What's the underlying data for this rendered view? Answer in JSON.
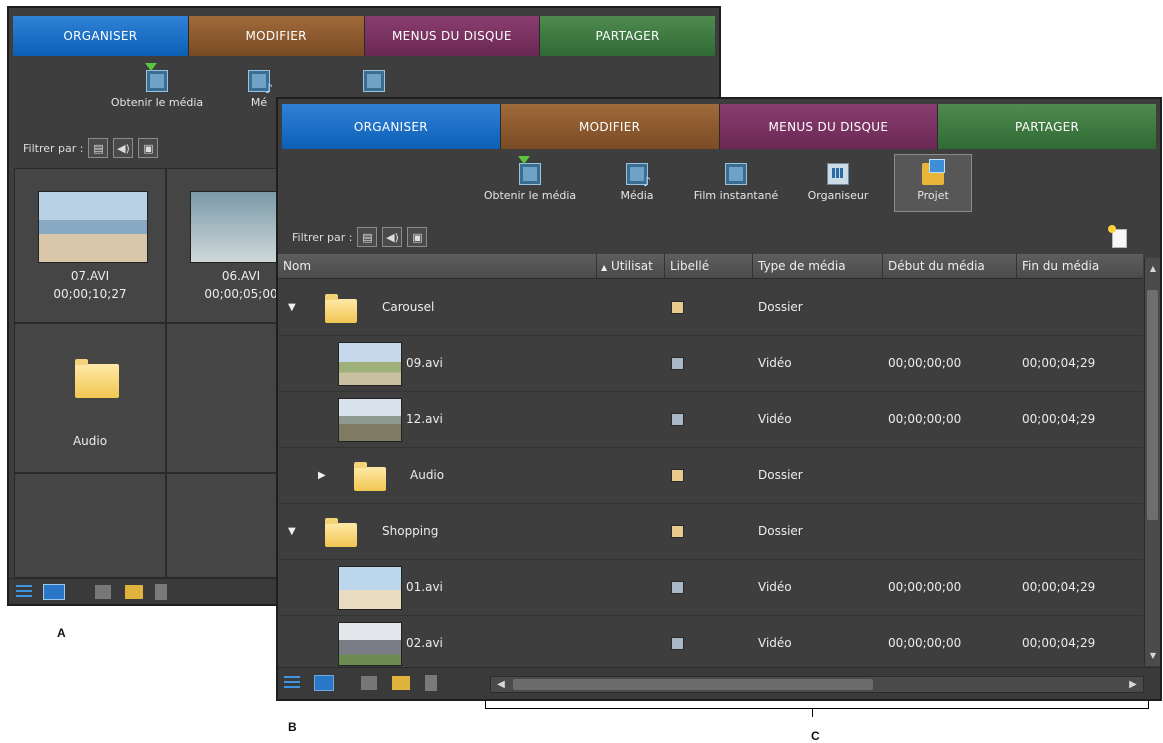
{
  "tabs": [
    "ORGANISER",
    "MODIFIER",
    "MENUS DU DISQUE",
    "PARTAGER"
  ],
  "back_panel": {
    "tools": [
      "Obtenir le média",
      "Mé"
    ],
    "filter_label": "Filtrer par :",
    "grid": [
      {
        "name": "07.AVI",
        "duration": "00;00;10;27"
      },
      {
        "name": "06.AVI",
        "duration": "00;00;05;00"
      },
      {
        "name": "Audio"
      }
    ]
  },
  "front_panel": {
    "tools": [
      "Obtenir le média",
      "Média",
      "Film instantané",
      "Organiseur",
      "Projet"
    ],
    "filter_label": "Filtrer par :",
    "columns": [
      "Nom",
      "Utilisat",
      "Libellé",
      "Type de média",
      "Début du média",
      "Fin du média"
    ],
    "rows": [
      {
        "name": "Carousel",
        "type": "Dossier",
        "start": "",
        "end": "",
        "expand": "open",
        "kind": "folder",
        "color": "#e8c98e"
      },
      {
        "name": "09.avi",
        "type": "Vidéo",
        "start": "00;00;00;00",
        "end": "00;00;04;29",
        "kind": "video",
        "color": "#a9b8c4"
      },
      {
        "name": "12.avi",
        "type": "Vidéo",
        "start": "00;00;00;00",
        "end": "00;00;04;29",
        "kind": "video",
        "color": "#a9b8c4"
      },
      {
        "name": "Audio",
        "type": "Dossier",
        "start": "",
        "end": "",
        "expand": "closed",
        "kind": "folder",
        "color": "#e8c98e"
      },
      {
        "name": "Shopping",
        "type": "Dossier",
        "start": "",
        "end": "",
        "expand": "open",
        "kind": "folder",
        "color": "#e8c98e"
      },
      {
        "name": "01.avi",
        "type": "Vidéo",
        "start": "00;00;00;00",
        "end": "00;00;04;29",
        "kind": "video",
        "color": "#a9b8c4"
      },
      {
        "name": "02.avi",
        "type": "Vidéo",
        "start": "00;00;00;00",
        "end": "00;00;04;29",
        "kind": "video",
        "color": "#a9b8c4"
      }
    ]
  },
  "captions": {
    "a": "A",
    "b": "B",
    "c": "C"
  }
}
